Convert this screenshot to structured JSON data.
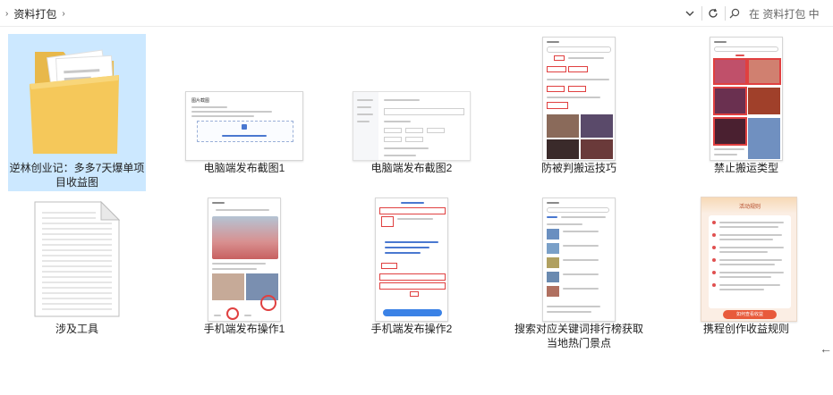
{
  "breadcrumb": {
    "folder": "资料打包"
  },
  "search": {
    "placeholder": "在 资料打包 中"
  },
  "items": [
    {
      "label": "逆林创业记：多多7天爆单项目收益图",
      "type": "folder"
    },
    {
      "label": "电脑端发布截图1",
      "type": "image"
    },
    {
      "label": "电脑端发布截图2",
      "type": "image"
    },
    {
      "label": "防被判搬运技巧",
      "type": "image"
    },
    {
      "label": "禁止搬运类型",
      "type": "image"
    },
    {
      "label": "涉及工具",
      "type": "document"
    },
    {
      "label": "手机端发布操作1",
      "type": "image"
    },
    {
      "label": "手机端发布操作2",
      "type": "image"
    },
    {
      "label": "搜索对应关键词排行榜获取当地热门景点",
      "type": "image"
    },
    {
      "label": "携程创作收益规则",
      "type": "image"
    }
  ],
  "thumb_text": {
    "pc1_title": "图片截图",
    "rules_title": "活动规则",
    "rules_button": "如何查看收益"
  }
}
